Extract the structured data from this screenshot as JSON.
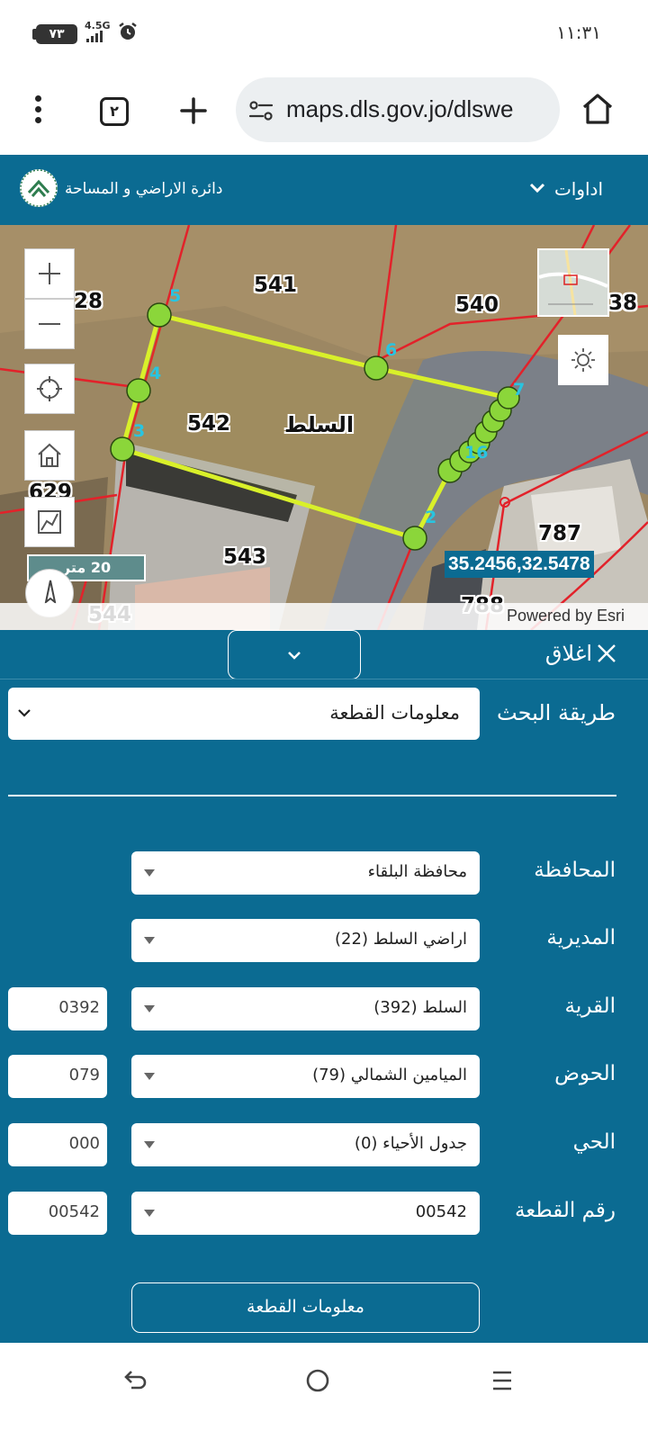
{
  "status_bar": {
    "time": "١١:٣١",
    "battery": "٧٣",
    "network": "4.5G"
  },
  "browser": {
    "url": "maps.dls.gov.jo/dlswe",
    "tab_count": "٢",
    "icons": [
      "menu-dots-icon",
      "tabs-icon",
      "plus-icon",
      "site-settings-icon",
      "home-icon"
    ]
  },
  "site": {
    "title": "دائرة الاراضي و المساحة",
    "tools_menu": "اداوات"
  },
  "map": {
    "parcel_labels": {
      "p541": "541",
      "p540": "540",
      "p542": "542",
      "p543": "543",
      "p544": "544",
      "p629": "629",
      "p787": "787",
      "p788": "788",
      "p28": "28",
      "p38": "38"
    },
    "town_label": "السلط",
    "vertex_labels": {
      "v2": "2",
      "v3": "3",
      "v4": "4",
      "v5": "5",
      "v6": "6",
      "v7": "7",
      "v16": "16"
    },
    "scale": "20 متر",
    "coordinates": "35.2456,32.5478",
    "attribution": "Powered by Esri",
    "colors": {
      "parcel_boundary": "#e2222a",
      "selected_parcel": "#d9f02a",
      "vertex": "#8bd63a",
      "vertex_label": "#29c4e0"
    }
  },
  "panel": {
    "close_label": "اغلاق",
    "search_method_label": "طريقة البحث",
    "search_method_value": "معلومات القطعة",
    "fields": {
      "governorate": {
        "label": "المحافظة",
        "value": "محافظة البلقاء"
      },
      "directorate": {
        "label": "المديرية",
        "value": "اراضي السلط (22)"
      },
      "village": {
        "label": "القرية",
        "value": "السلط (392)",
        "code": "0392"
      },
      "basin": {
        "label": "الحوض",
        "value": "الميامين الشمالي (79)",
        "code": "079"
      },
      "neighborhood": {
        "label": "الحي",
        "value": "جدول الأحياء (0)",
        "code": "000"
      },
      "parcel": {
        "label": "رقم القطعة",
        "value": "00542",
        "code": "00542"
      }
    },
    "submit_label": "معلومات القطعة",
    "colors": {
      "background": "#0b6b92"
    }
  }
}
